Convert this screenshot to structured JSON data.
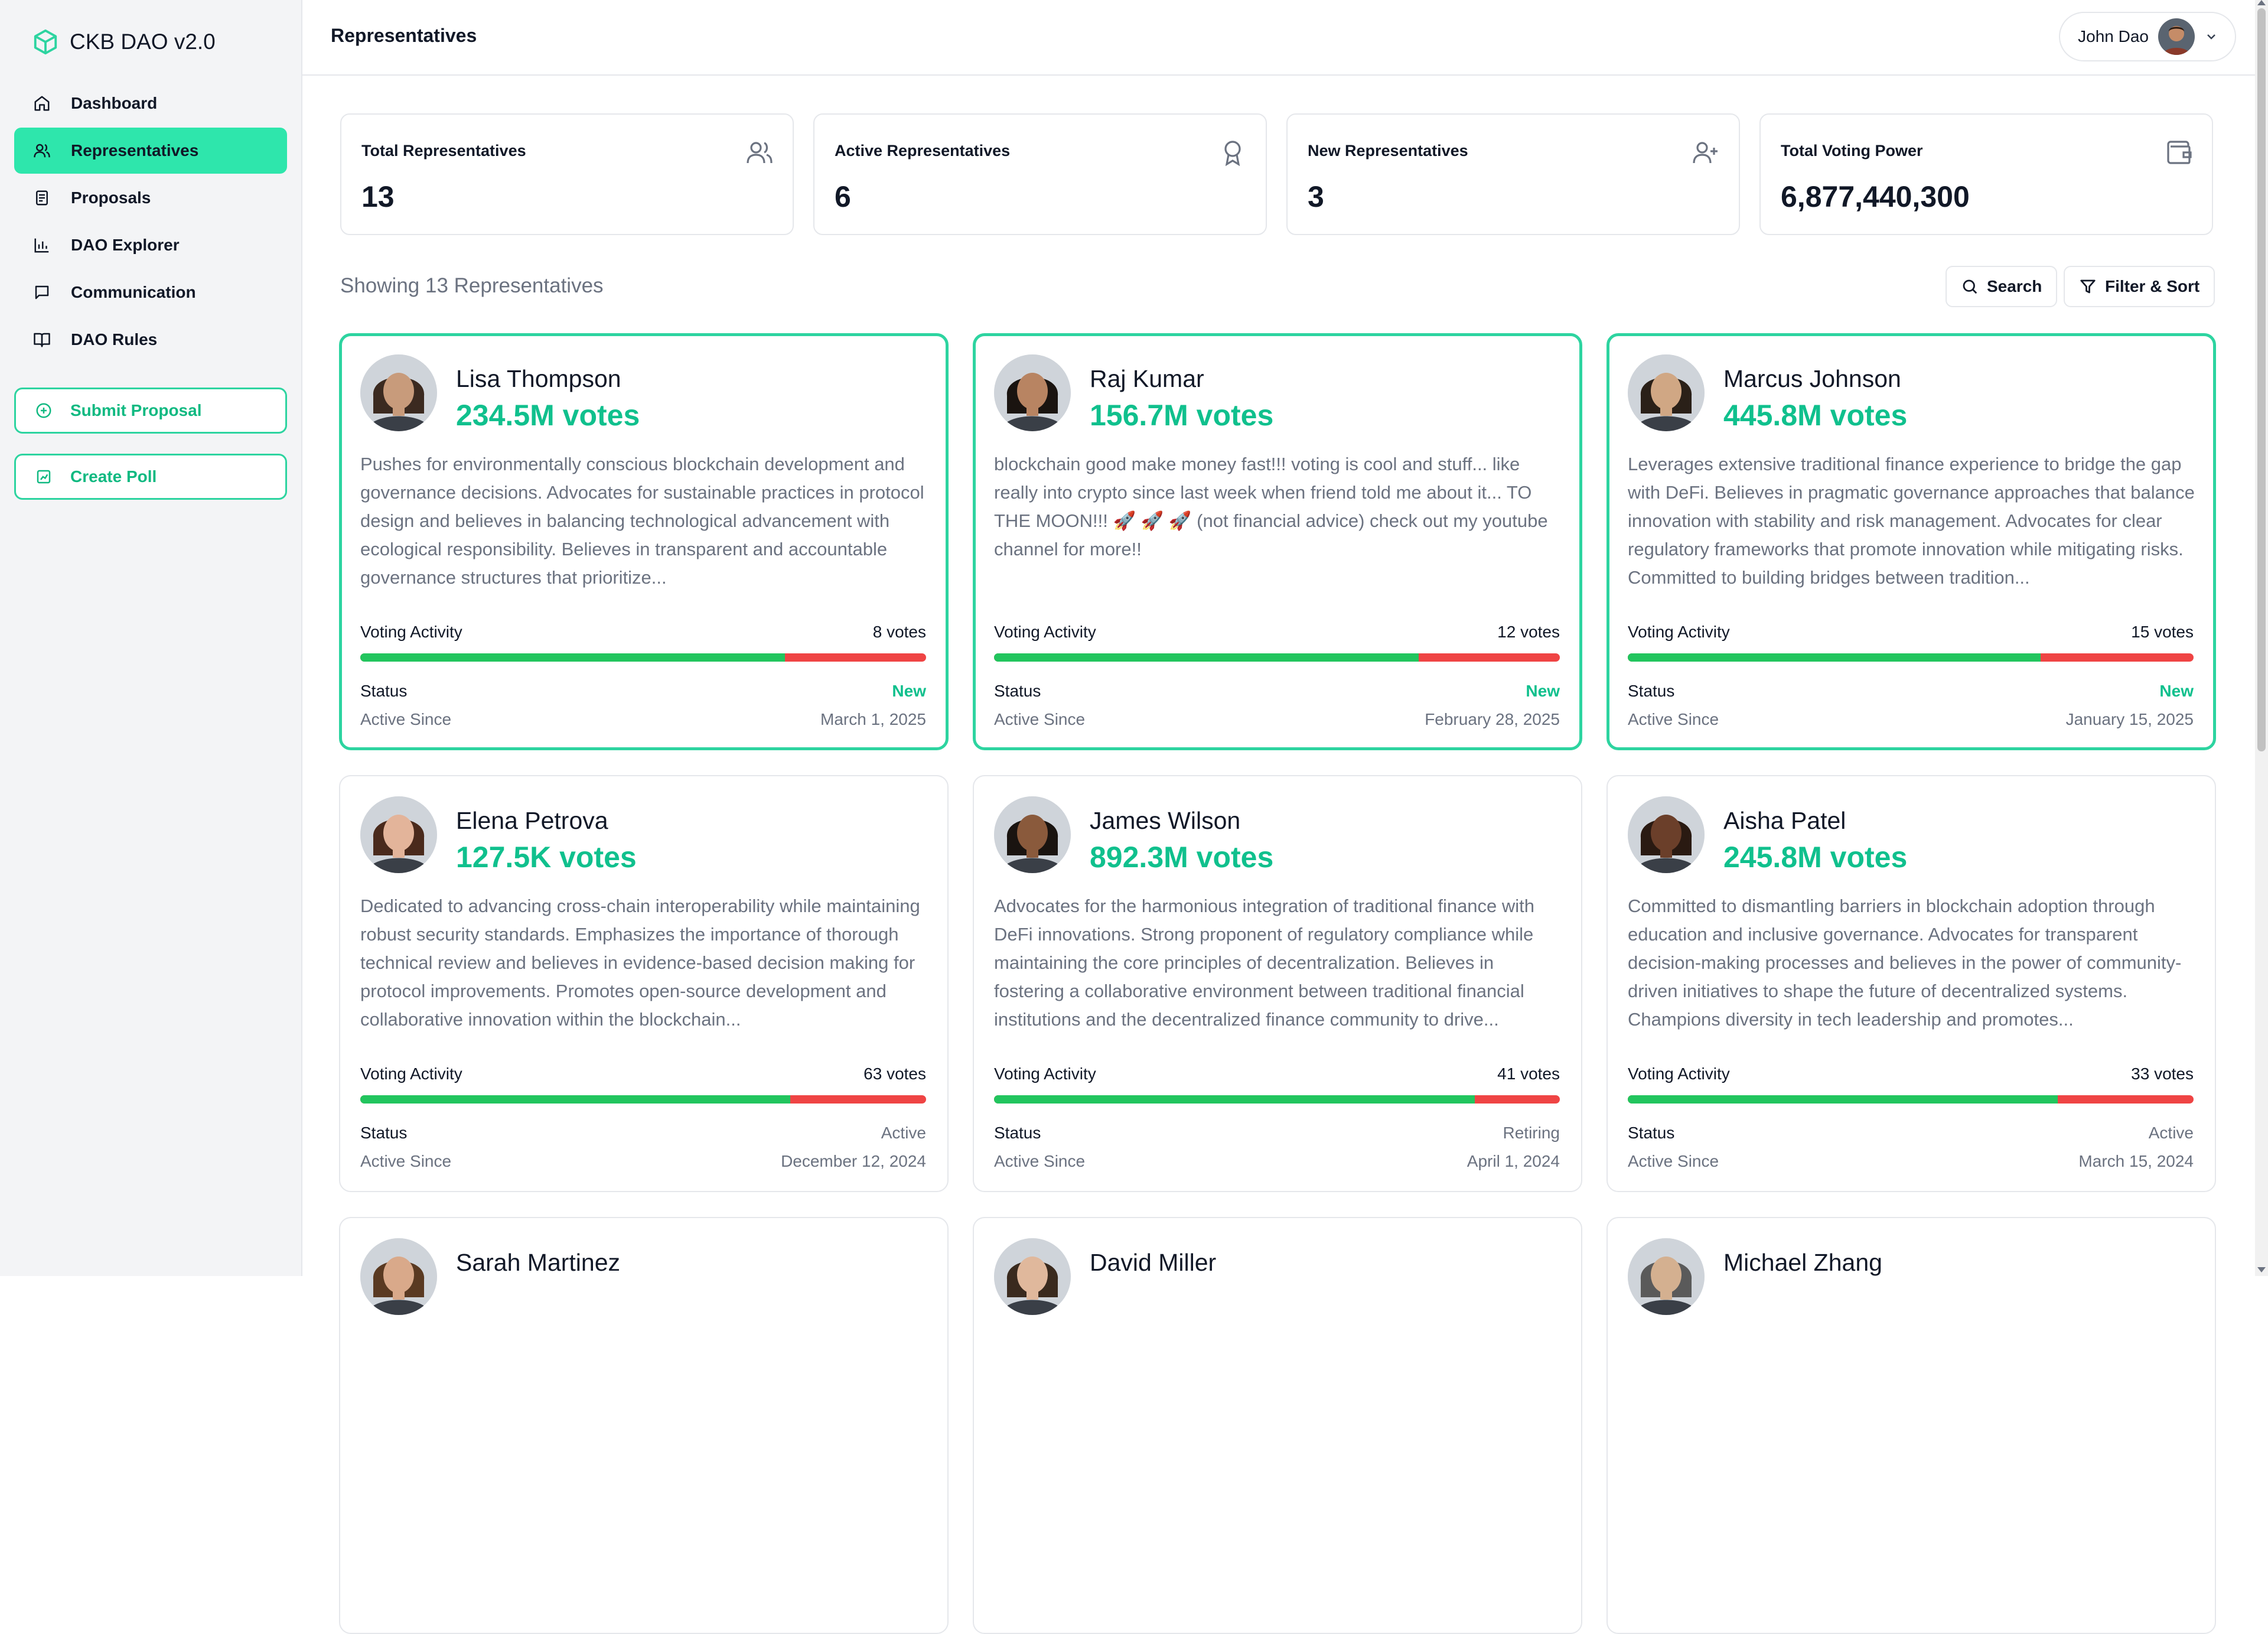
{
  "app": {
    "title": "CKB DAO v2.0"
  },
  "sidebar": {
    "items": [
      {
        "label": "Dashboard",
        "icon": "home-icon"
      },
      {
        "label": "Representatives",
        "icon": "users-icon",
        "active": true
      },
      {
        "label": "Proposals",
        "icon": "document-icon"
      },
      {
        "label": "DAO Explorer",
        "icon": "bar-chart-icon"
      },
      {
        "label": "Communication",
        "icon": "message-icon"
      },
      {
        "label": "DAO Rules",
        "icon": "book-icon"
      }
    ],
    "submit_proposal": "Submit Proposal",
    "create_poll": "Create Poll"
  },
  "header": {
    "title": "Representatives",
    "user_name": "John Dao"
  },
  "stats": [
    {
      "label": "Total Representatives",
      "value": "13",
      "icon": "users-icon"
    },
    {
      "label": "Active Representatives",
      "value": "6",
      "icon": "award-icon"
    },
    {
      "label": "New Representatives",
      "value": "3",
      "icon": "user-plus-icon"
    },
    {
      "label": "Total Voting Power",
      "value": "6,877,440,300",
      "icon": "wallet-icon"
    }
  ],
  "list": {
    "showing": "Showing 13 Representatives",
    "search_label": "Search",
    "filter_label": "Filter & Sort"
  },
  "cards": [
    {
      "name": "Lisa Thompson",
      "votes": "234.5M votes",
      "description": "Pushes for environmentally conscious blockchain development and governance decisions. Advocates for sustainable practices in protocol design and believes in balancing technological advancement with ecological responsibility. Believes in transparent and accountable governance structures that prioritize...",
      "voting_activity_label": "Voting Activity",
      "vote_count": "8 votes",
      "approval_fraction": 0.75,
      "status_label": "Status",
      "status": "New",
      "since_label": "Active Since",
      "since": "March 1, 2025",
      "highlight": true,
      "skin": "#c89b7b",
      "hair": "#3b2a20"
    },
    {
      "name": "Raj Kumar",
      "votes": "156.7M votes",
      "description": "blockchain good make money fast!!! voting is cool and stuff... like really into crypto since last week when friend told me about it... TO THE MOON!!! 🚀 🚀 🚀 (not financial advice) check out my youtube channel for more!!",
      "voting_activity_label": "Voting Activity",
      "vote_count": "12 votes",
      "approval_fraction": 0.75,
      "status_label": "Status",
      "status": "New",
      "since_label": "Active Since",
      "since": "February 28, 2025",
      "highlight": true,
      "skin": "#b88462",
      "hair": "#1a1410"
    },
    {
      "name": "Marcus Johnson",
      "votes": "445.8M votes",
      "description": "Leverages extensive traditional finance experience to bridge the gap with DeFi. Believes in pragmatic governance approaches that balance innovation with stability and risk management. Advocates for clear regulatory frameworks that promote innovation while mitigating risks. Committed to building bridges between tradition...",
      "voting_activity_label": "Voting Activity",
      "vote_count": "15 votes",
      "approval_fraction": 0.73,
      "status_label": "Status",
      "status": "New",
      "since_label": "Active Since",
      "since": "January 15, 2025",
      "highlight": true,
      "skin": "#d0a784",
      "hair": "#2a2018"
    },
    {
      "name": "Elena Petrova",
      "votes": "127.5K votes",
      "description": "Dedicated to advancing cross-chain interoperability while maintaining robust security standards. Emphasizes the importance of thorough technical review and believes in evidence-based decision making for protocol improvements. Promotes open-source development and collaborative innovation within the blockchain...",
      "voting_activity_label": "Voting Activity",
      "vote_count": "63 votes",
      "approval_fraction": 0.76,
      "status_label": "Status",
      "status": "Active",
      "since_label": "Active Since",
      "since": "December 12, 2024",
      "highlight": false,
      "skin": "#e3b49a",
      "hair": "#4a2a1c"
    },
    {
      "name": "James Wilson",
      "votes": "892.3M votes",
      "description": "Advocates for the harmonious integration of traditional finance with DeFi innovations. Strong proponent of regulatory compliance while maintaining the core principles of decentralization. Believes in fostering a collaborative environment between traditional financial institutions and the decentralized finance community to drive...",
      "voting_activity_label": "Voting Activity",
      "vote_count": "41 votes",
      "approval_fraction": 0.85,
      "status_label": "Status",
      "status": "Retiring",
      "since_label": "Active Since",
      "since": "April 1, 2024",
      "highlight": false,
      "skin": "#8a5a3c",
      "hair": "#1a1410"
    },
    {
      "name": "Aisha Patel",
      "votes": "245.8M votes",
      "description": "Committed to dismantling barriers in blockchain adoption through education and inclusive governance. Advocates for transparent decision-making processes and believes in the power of community-driven initiatives to shape the future of decentralized systems. Champions diversity in tech leadership and promotes...",
      "voting_activity_label": "Voting Activity",
      "vote_count": "33 votes",
      "approval_fraction": 0.76,
      "status_label": "Status",
      "status": "Active",
      "since_label": "Active Since",
      "since": "March 15, 2024",
      "highlight": false,
      "skin": "#6b3f2a",
      "hair": "#2a1a12"
    },
    {
      "name": "Sarah Martinez",
      "skin": "#d9a98a",
      "hair": "#5a3a22"
    },
    {
      "name": "David Miller",
      "skin": "#e0b89c",
      "hair": "#3a2a1e"
    },
    {
      "name": "Michael Zhang",
      "skin": "#d4b090",
      "hair": "#5a5a5a"
    }
  ]
}
